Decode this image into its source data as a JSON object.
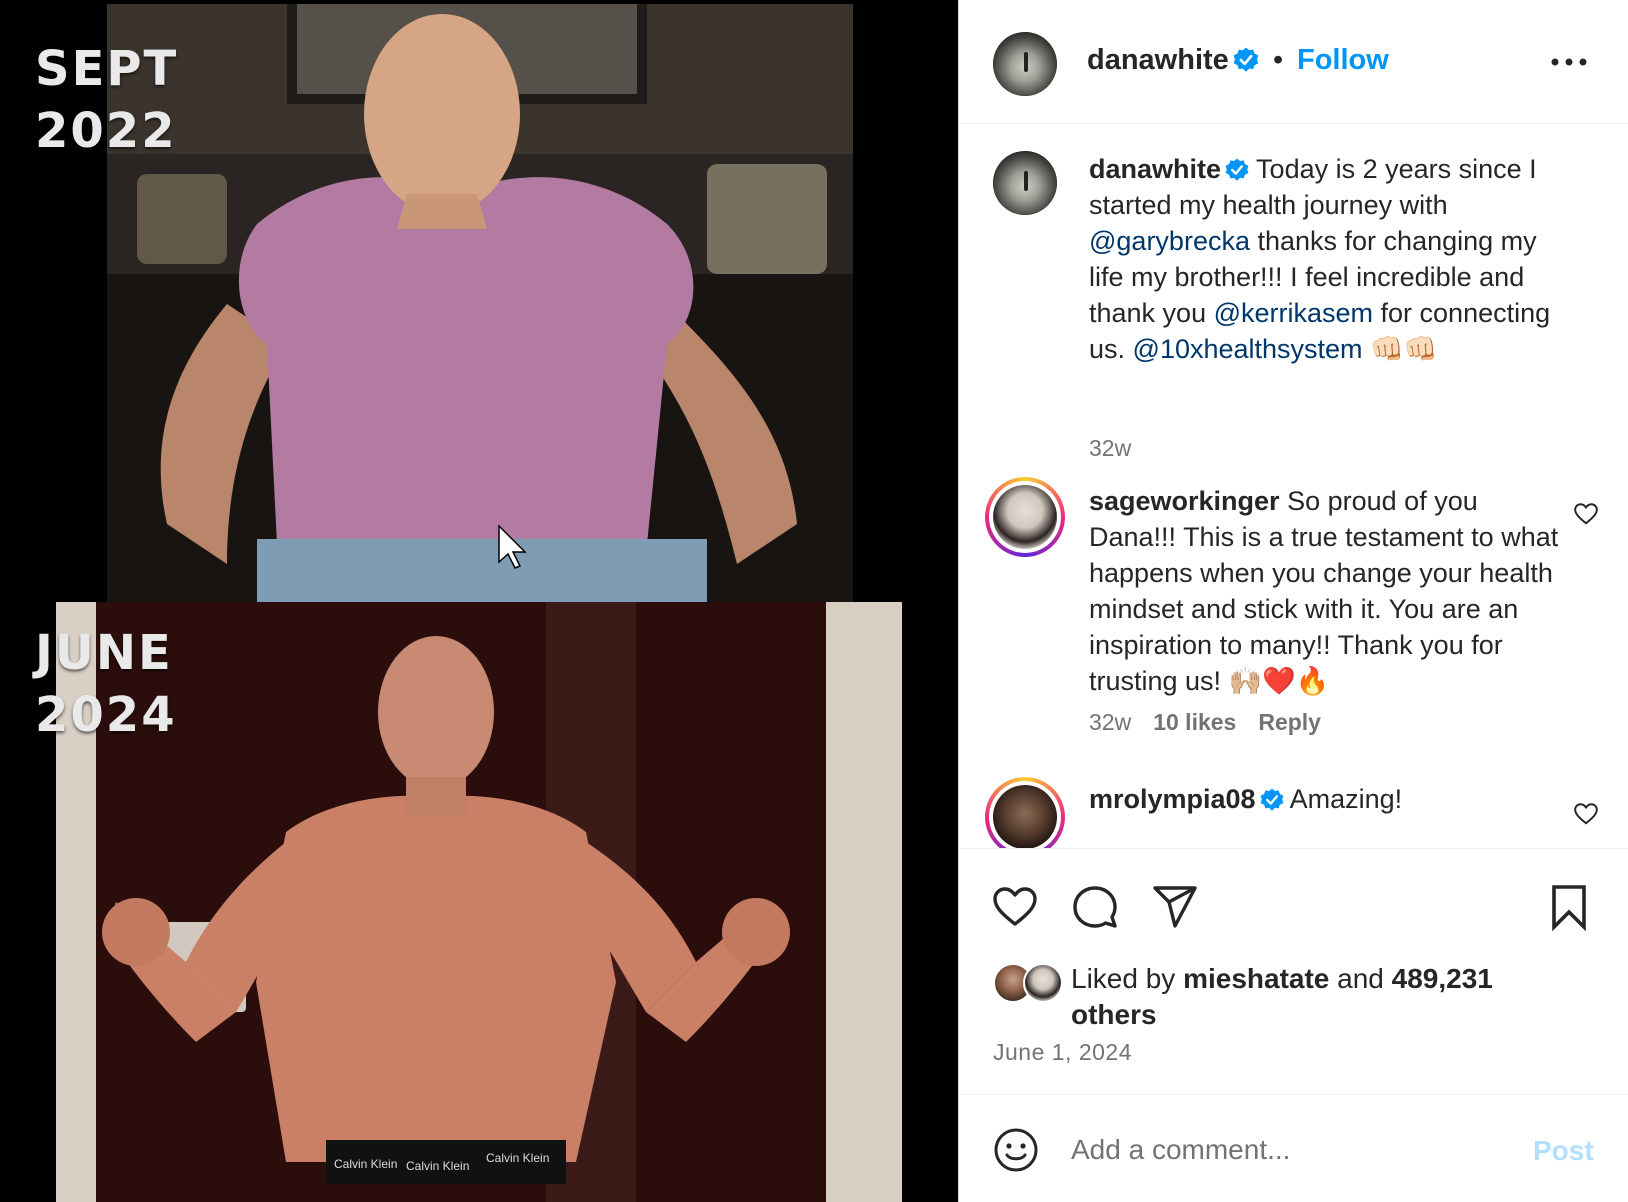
{
  "media": {
    "top_label_line1": "SEPT",
    "top_label_line2": "2022",
    "bottom_label_line1": "JUNE",
    "bottom_label_line2": "2024",
    "waistband_text": "Calvin Klein"
  },
  "header": {
    "username": "danawhite",
    "separator": "•",
    "follow_label": "Follow",
    "more_icon": "more-horizontal-icon"
  },
  "caption": {
    "username": "danawhite",
    "text_1": "Today is 2 years since I started my health journey with ",
    "mention_1": "@garybrecka",
    "text_2": " thanks for changing my life my brother!!! I feel incredible and thank you ",
    "mention_2": "@kerrikasem",
    "text_3": " for connecting us. ",
    "mention_3": "@10xhealthsystem",
    "emoji": " 👊🏻👊🏻",
    "time": "32w"
  },
  "comments": [
    {
      "username": "sageworkinger",
      "text": "So proud of you Dana!!! This is a true testament to what happens when you change your health mindset and stick with it. You are an inspiration to many!! Thank you for trusting us! 🙌🏼❤️🔥",
      "time": "32w",
      "likes": "10 likes",
      "reply": "Reply"
    },
    {
      "username": "mrolympia08",
      "text": "Amazing!"
    }
  ],
  "actions": {
    "like_icon": "heart-icon",
    "comment_icon": "comment-icon",
    "share_icon": "send-icon",
    "save_icon": "bookmark-icon",
    "liked_prefix": "Liked by ",
    "liked_user": "mieshatate",
    "liked_middle": " and ",
    "liked_count": "489,231 others",
    "date": "June 1, 2024"
  },
  "add_comment": {
    "placeholder": "Add a comment...",
    "post_label": "Post"
  },
  "colors": {
    "accent": "#0095f6",
    "mention": "#00376b",
    "muted": "#737373",
    "post_disabled": "#b2dffc"
  }
}
